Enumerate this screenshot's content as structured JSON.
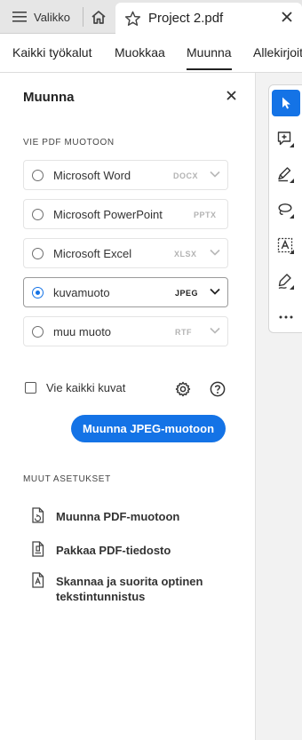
{
  "topbar": {
    "menu_label": "Valikko",
    "doc_title": "Project 2.pdf"
  },
  "nav": {
    "items": [
      "Kaikki työkalut",
      "Muokkaa",
      "Muunna",
      "Allekirjoit"
    ],
    "active": "Muunna"
  },
  "panel": {
    "title": "Muunna",
    "export_heading": "VIE PDF MUOTOON",
    "options": [
      {
        "label": "Microsoft Word",
        "format": "DOCX",
        "selected": false
      },
      {
        "label": "Microsoft PowerPoint",
        "format": "PPTX",
        "selected": false
      },
      {
        "label": "Microsoft Excel",
        "format": "XLSX",
        "selected": false
      },
      {
        "label": "kuvamuoto",
        "format": "JPEG",
        "selected": true
      },
      {
        "label": "muu muoto",
        "format": "RTF",
        "selected": false
      }
    ],
    "export_all_label": "Vie kaikki kuvat",
    "convert_button": "Muunna JPEG-muotoon",
    "other_heading": "MUUT ASETUKSET",
    "other_items": [
      {
        "label": "Muunna PDF-muotoon",
        "icon": "convert-pdf-icon"
      },
      {
        "label": "Pakkaa PDF-tiedosto",
        "icon": "compress-pdf-icon"
      },
      {
        "label": "Skannaa ja suorita optinen tekstintunnistus",
        "label_line1": "Skannaa ja suorita optinen",
        "label_line2": "tekstintunnistus",
        "icon": "ocr-icon"
      }
    ]
  },
  "colors": {
    "accent": "#1473e6",
    "topbar_bg": "#e6e6e6",
    "rail_bg": "#f2f2f2"
  }
}
